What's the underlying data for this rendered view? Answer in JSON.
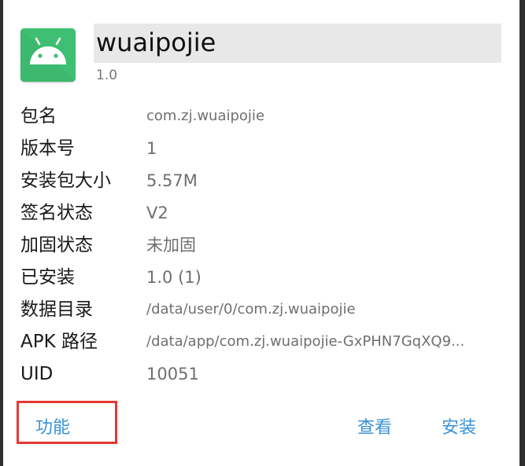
{
  "app": {
    "name": "wuaipojie",
    "version": "1.0",
    "icon": "android-icon",
    "icon_color": "#3fbf72"
  },
  "info_rows": [
    {
      "label": "包名",
      "value": "com.zj.wuaipojie"
    },
    {
      "label": "版本号",
      "value": "1"
    },
    {
      "label": "安装包大小",
      "value": "5.57M"
    },
    {
      "label": "签名状态",
      "value": "V2"
    },
    {
      "label": "加固状态",
      "value": "未加固"
    },
    {
      "label": "已安装",
      "value": "1.0 (1)"
    },
    {
      "label": "数据目录",
      "value": "/data/user/0/com.zj.wuaipojie"
    },
    {
      "label": "APK 路径",
      "value": "/data/app/com.zj.wuaipojie-GxPHN7GqXQ9..."
    },
    {
      "label": "UID",
      "value": "10051"
    }
  ],
  "actions": {
    "function_label": "功能",
    "view_label": "查看",
    "install_label": "安装"
  },
  "colors": {
    "accent": "#3a92d8",
    "highlight": "#e53935"
  }
}
